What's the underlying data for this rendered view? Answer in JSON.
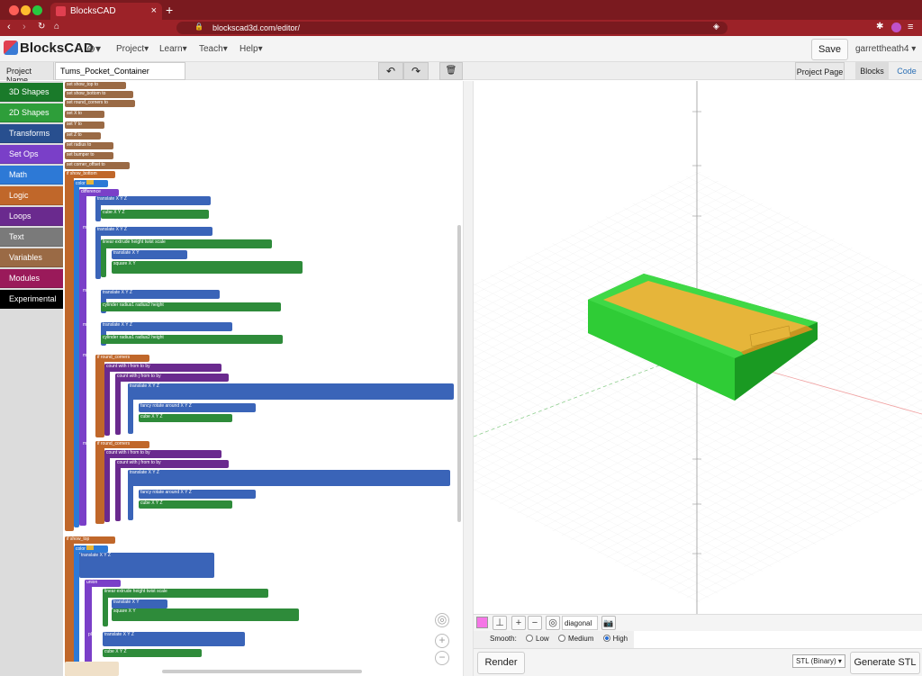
{
  "browser": {
    "tab_title": "BlocksCAD",
    "url": "blockscad3d.com/editor/",
    "new_tab": "+",
    "close": "×"
  },
  "header": {
    "logo": "BlocksCAD",
    "menus": [
      "Project",
      "Learn",
      "Teach",
      "Help"
    ],
    "save": "Save",
    "user": "garrettheath4"
  },
  "project": {
    "label": "Project Name",
    "name": "Tums_Pocket_Container",
    "project_page": "Project Page",
    "tabs": [
      "Blocks",
      "Code"
    ]
  },
  "colors": {
    "3d": "#1a7a2a",
    "2d": "#2e9e3a",
    "transforms": "#284f8f",
    "setops": "#7a3fc8",
    "math": "#2d79d6",
    "logic": "#c0672a",
    "loops": "#6a2a8e",
    "text": "#7a7a7a",
    "variables": "#9a6a45",
    "modules": "#9a1a5a",
    "experimental": "#000000",
    "vars": "#c0672a",
    "loop": "#6a2a8e",
    "transform": "#3a64b8",
    "shape": "#2e8b3a",
    "setop": "#7a3fc8",
    "fill": "#e6b53a"
  },
  "toolbox": [
    "3D Shapes",
    "2D Shapes",
    "Transforms",
    "Set Ops",
    "Math",
    "Logic",
    "Loops",
    "Text",
    "Variables",
    "Modules",
    "Experimental"
  ],
  "workspace": {
    "set_vars": [
      "show_top",
      "show_bottom",
      "round_corners",
      "X",
      "Y",
      "Z",
      "radius",
      "bumper",
      "corner_offset"
    ],
    "blocks": [
      "if show_bottom",
      "difference",
      "translate",
      "cube",
      "minus",
      "translate",
      "linear extrude",
      "translate",
      "square",
      "translate",
      "cylinder",
      "translate",
      "cylinder",
      "if round_corners",
      "count with i",
      "count with j",
      "translate",
      "fancy rotate",
      "cube",
      "if round_corners",
      "count with i",
      "count with j",
      "translate",
      "fancy rotate",
      "cube",
      "if show_top",
      "union",
      "linear extrude",
      "translate",
      "square",
      "translate",
      "cube"
    ]
  },
  "viewport": {
    "view": "diagonal",
    "smooth_label": "Smooth:",
    "smooth_options": [
      "Low",
      "Medium",
      "High"
    ],
    "smooth_selected": "High"
  },
  "bottom": {
    "render": "Render",
    "format": "STL (Binary)",
    "generate": "Generate STL"
  }
}
